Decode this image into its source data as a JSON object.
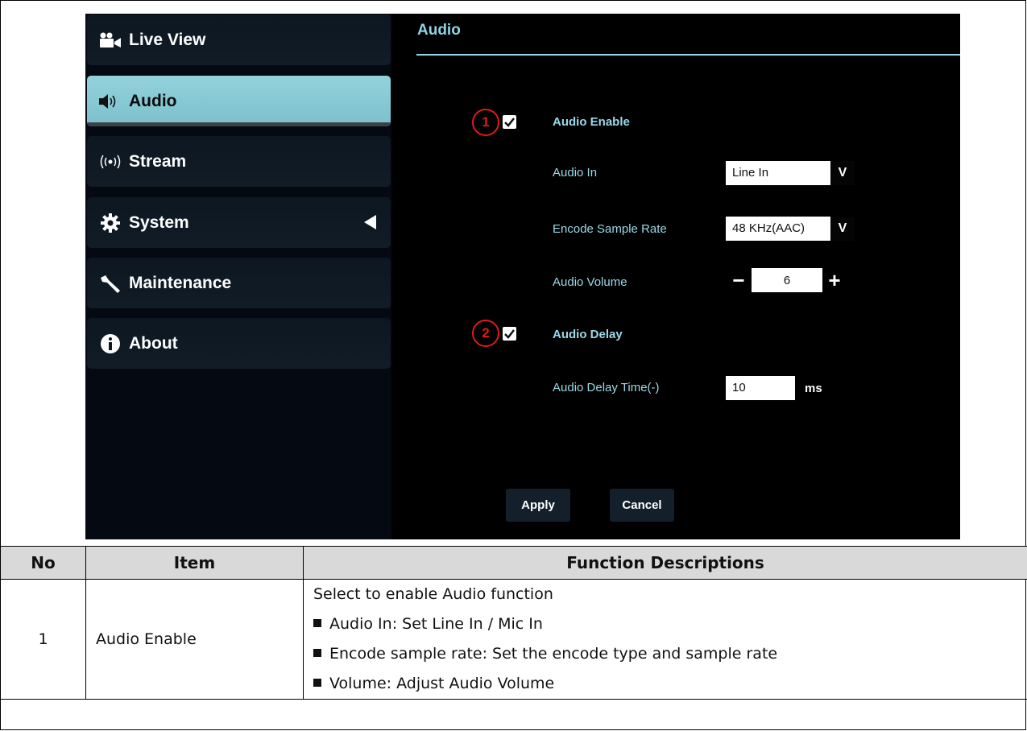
{
  "sidebar": {
    "items": [
      {
        "label": "Live View",
        "icon": "video-camera-icon"
      },
      {
        "label": "Audio",
        "icon": "speaker-icon",
        "active": true
      },
      {
        "label": "Stream",
        "icon": "broadcast-icon"
      },
      {
        "label": "System",
        "icon": "gear-icon"
      },
      {
        "label": "Maintenance",
        "icon": "wrench-icon"
      },
      {
        "label": "About",
        "icon": "info-icon"
      }
    ]
  },
  "main": {
    "title": "Audio",
    "audio_enable": {
      "marker": "1",
      "label": "Audio Enable",
      "checked": true
    },
    "audio_in": {
      "label": "Audio In",
      "value": "Line In",
      "caret": "V"
    },
    "encode_sample_rate": {
      "label": "Encode Sample Rate",
      "value": "48 KHz(AAC)",
      "caret": "V"
    },
    "audio_volume": {
      "label": "Audio Volume",
      "value": "6",
      "minus": "−",
      "plus": "+"
    },
    "audio_delay": {
      "marker": "2",
      "label": "Audio Delay",
      "checked": true
    },
    "audio_delay_time": {
      "label": "Audio Delay Time(-)",
      "value": "10",
      "unit": "ms"
    },
    "apply_label": "Apply",
    "cancel_label": "Cancel"
  },
  "table": {
    "headers": {
      "no": "No",
      "item": "Item",
      "desc": "Function Descriptions"
    },
    "rows": [
      {
        "no": "1",
        "item": "Audio Enable",
        "lines": [
          "Select to enable Audio function",
          "Audio In: Set Line In / Mic In",
          "Encode sample rate: Set the encode type and sample rate",
          "Volume: Adjust Audio Volume"
        ]
      }
    ]
  },
  "colors": {
    "accent": "#8fd5e4",
    "active_nav": "#8ccfd9",
    "marker_red": "#e01a1a",
    "header_gray": "#d9d9d9"
  }
}
